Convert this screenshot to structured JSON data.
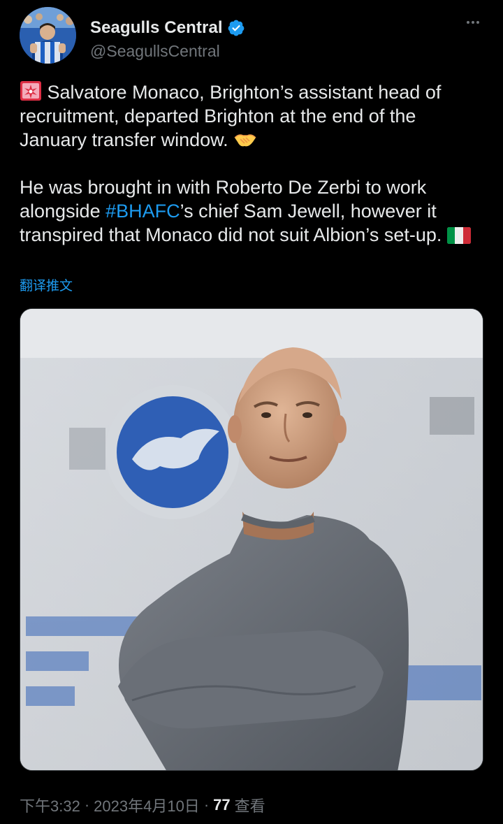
{
  "author": {
    "display_name": "Seagulls Central",
    "handle": "@SeagullsCentral",
    "verified": true,
    "verified_color": "#1d9bf0"
  },
  "icons": {
    "more": "more-horizontal-icon",
    "siren": "police-light-emoji",
    "handshake": "handshake-emoji",
    "flag": "italy-flag-emoji"
  },
  "tweet": {
    "para1_text": " Salvatore Monaco, Brighton’s assistant head of recruitment, departed Brighton at the end of the January transfer window. ",
    "para2_before": "He was brought in with Roberto De Zerbi to work alongside ",
    "hashtag": "#BHAFC",
    "para2_after": "’s chief Sam Jewell, however it transpired that Monaco did not suit Albion’s set-up. "
  },
  "translate_label": "翻译推文",
  "footer": {
    "time": "下午3:32",
    "separator": "·",
    "date": "2023年4月10日",
    "views_count": "77",
    "views_label": "查看"
  },
  "colors": {
    "background": "#000000",
    "text": "#e7e9ea",
    "muted": "#71767b",
    "accent": "#1d9bf0",
    "brighton_blue": "#0057b8"
  }
}
